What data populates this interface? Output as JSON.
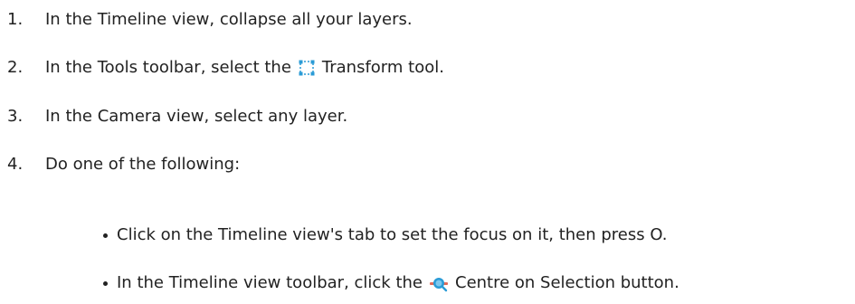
{
  "steps": [
    {
      "number": "1.",
      "text": "In the Timeline view, collapse all your layers."
    },
    {
      "number": "2.",
      "text_before": "In the Tools toolbar, select the",
      "icon": "transform-tool-icon",
      "text_after": "Transform tool."
    },
    {
      "number": "3.",
      "text": "In the Camera view, select any layer."
    },
    {
      "number": "4.",
      "text": "Do one of the following:"
    }
  ],
  "sub_items": [
    {
      "text": "Click on the Timeline view's tab to set the focus on it, then press O."
    },
    {
      "text_before": "In the Timeline view toolbar, click the",
      "icon": "centre-on-selection-icon",
      "text_after": "Centre on Selection button."
    }
  ],
  "colors": {
    "text": "#222222",
    "transform_icon": "#2a9bd6",
    "centre_icon_lens": "#2a9bd6",
    "centre_icon_bar": "#e06b5a"
  }
}
